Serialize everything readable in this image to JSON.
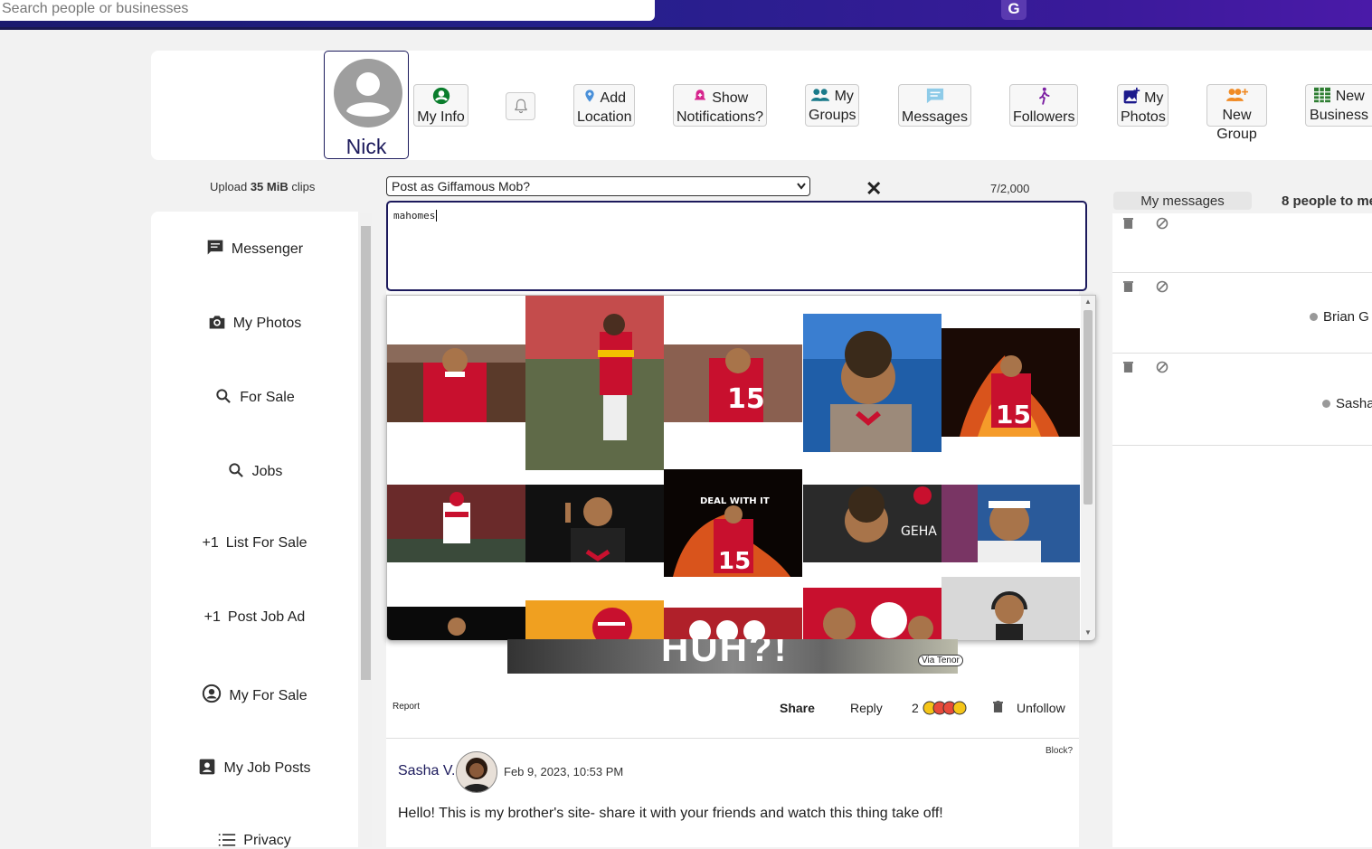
{
  "header": {
    "search_placeholder": "Search people or businesses",
    "logo_letter": "G"
  },
  "profile": {
    "name": "Nick"
  },
  "nav": {
    "my_info": [
      "My",
      "Info"
    ],
    "add_location": [
      "Add",
      "Location"
    ],
    "show_notifications": [
      "Show",
      "Notifications?"
    ],
    "my_groups": [
      "My",
      "Groups"
    ],
    "messages": "Messages",
    "followers": "Followers",
    "my_photos": [
      "My",
      "Photos"
    ],
    "new_group": [
      "New",
      "Group"
    ],
    "new_business": [
      "New",
      "Business"
    ]
  },
  "upload": {
    "prefix": "Upload ",
    "size": "35 MiB",
    "suffix": " clips"
  },
  "sidebar": {
    "items": [
      {
        "label": "Messenger",
        "icon": "chat-icon"
      },
      {
        "label": "My Photos",
        "icon": "camera-icon"
      },
      {
        "label": "For Sale",
        "icon": "search-icon"
      },
      {
        "label": "Jobs",
        "icon": "search-icon"
      },
      {
        "label": "List For Sale",
        "prefix": "+1"
      },
      {
        "label": "Post Job Ad",
        "prefix": "+1"
      },
      {
        "label": "My For Sale",
        "icon": "account-circle-icon"
      },
      {
        "label": "My Job Posts",
        "icon": "account-box-icon"
      },
      {
        "label": "Privacy",
        "icon": "list-icon"
      }
    ]
  },
  "composer": {
    "post_as": "Post as Giffamous Mob?",
    "close": "✕",
    "char_count": "7/2,000",
    "text": "mahomes"
  },
  "gif_results": {
    "count_visible": 15,
    "attribution": "Via Tenor",
    "preview_caption": "HUH?!"
  },
  "post_actions": {
    "report": "Report",
    "share": "Share",
    "reply": "Reply",
    "reaction_count": "2",
    "unfollow": "Unfollow"
  },
  "post": {
    "block": "Block?",
    "author": "Sasha V.",
    "date": "Feb 9, 2023, 10:53 PM",
    "text": "Hello! This is my brother's site-  share it with your friends and watch this thing take off!"
  },
  "right_panel": {
    "tab_label": "My messages",
    "people_label": "8 people to me",
    "conversations": [
      {
        "name": ""
      },
      {
        "name": "Brian G"
      },
      {
        "name": "Sasha"
      }
    ]
  },
  "colors": {
    "brand_dark": "#1c1a5c",
    "header_gradient_start": "#1b1a6e",
    "header_gradient_end": "#4a1aa8",
    "chiefs_red": "#c8102e"
  }
}
